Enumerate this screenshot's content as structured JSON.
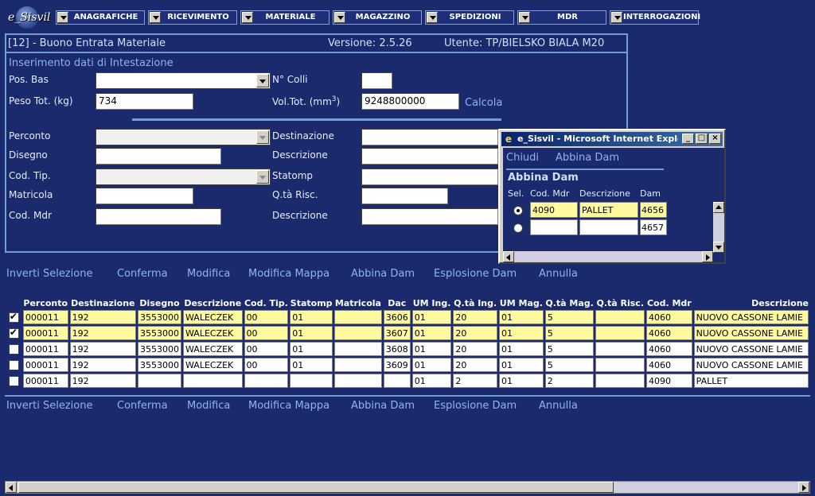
{
  "logo_text": "e_Sisvil",
  "menu": [
    {
      "label": "ANAGRAFICHE"
    },
    {
      "label": "RICEVIMENTO"
    },
    {
      "label": "MATERIALE"
    },
    {
      "label": "MAGAZZINO"
    },
    {
      "label": "SPEDIZIONI"
    },
    {
      "label": "MDR"
    },
    {
      "label": "INTERROGAZIONI"
    }
  ],
  "header": {
    "title": "[12] - Buono Entrata Materiale",
    "version": "Versione: 2.5.26",
    "user": "Utente: TP/BIELSKO BIALA M20"
  },
  "section_title": "Inserimento dati di Intestazione",
  "fields": {
    "pos_bas": {
      "label": "Pos. Bas",
      "value": ""
    },
    "n_colli": {
      "label": "N° Colli",
      "value": ""
    },
    "peso_tot": {
      "label": "Peso Tot. (kg)",
      "value": "734"
    },
    "vol_tot": {
      "label": "Vol.Tot. (mm",
      "sup": "3",
      "label_end": ")",
      "value": "9248800000"
    },
    "calcola": "Calcola",
    "perconto": {
      "label": "Perconto",
      "value": ""
    },
    "destinazione": {
      "label": "Destinazione",
      "value": ""
    },
    "disegno": {
      "label": "Disegno",
      "value": ""
    },
    "descrizione": {
      "label": "Descrizione",
      "value": ""
    },
    "cod_tip": {
      "label": "Cod. Tip.",
      "value": ""
    },
    "statomp": {
      "label": "Statomp",
      "value": ""
    },
    "matricola": {
      "label": "Matricola",
      "value": ""
    },
    "qta_risc": {
      "label": "Q.tà Risc.",
      "value": ""
    },
    "cod_mdr": {
      "label": "Cod. Mdr",
      "value": ""
    },
    "descrizione2": {
      "label": "Descrizione",
      "value": ""
    }
  },
  "actions": [
    "Inverti Selezione",
    "Conferma",
    "Modifica",
    "Modifica Mappa",
    "Abbina Dam",
    "Esplosione Dam",
    "Annulla"
  ],
  "grid": {
    "columns": [
      "Perconto",
      "Destinazione",
      "Disegno",
      "Descrizione",
      "Cod. Tip.",
      "Statomp",
      "Matricola",
      "Dac",
      "UM Ing.",
      "Q.tà Ing.",
      "UM Mag.",
      "Q.tà Mag.",
      "Q.tà Risc.",
      "Cod. Mdr",
      "Descrizione"
    ],
    "rows": [
      {
        "checked": true,
        "cells": [
          "000011",
          "192",
          "3553000",
          "WALECZEK",
          "00",
          "01",
          "",
          "3606",
          "01",
          "20",
          "01",
          "5",
          "",
          "4060",
          "NUOVO CASSONE LAMIE"
        ]
      },
      {
        "checked": true,
        "cells": [
          "000011",
          "192",
          "3553000",
          "WALECZEK",
          "00",
          "01",
          "",
          "3607",
          "01",
          "20",
          "01",
          "5",
          "",
          "4060",
          "NUOVO CASSONE LAMIE"
        ]
      },
      {
        "checked": false,
        "cells": [
          "000011",
          "192",
          "3553000",
          "WALECZEK",
          "00",
          "01",
          "",
          "3608",
          "01",
          "20",
          "01",
          "5",
          "",
          "4060",
          "NUOVO CASSONE LAMIE"
        ]
      },
      {
        "checked": false,
        "cells": [
          "000011",
          "192",
          "3553000",
          "WALECZEK",
          "00",
          "01",
          "",
          "3609",
          "01",
          "20",
          "01",
          "5",
          "",
          "4060",
          "NUOVO CASSONE LAMIE"
        ]
      },
      {
        "checked": false,
        "cells": [
          "000011",
          "192",
          "",
          "",
          "",
          "",
          "",
          "",
          "01",
          "2",
          "01",
          "2",
          "",
          "4090",
          "PALLET"
        ]
      }
    ]
  },
  "popup": {
    "title": "e_Sisvil - Microsoft Internet Explor...",
    "link_close": "Chiudi",
    "link_abbina": "Abbina Dam",
    "table_title": "Abbina Dam",
    "columns": [
      "Sel.",
      "Cod. Mdr",
      "Descrizione",
      "Dam"
    ],
    "rows": [
      {
        "selected": true,
        "cod_mdr": "4090",
        "descrizione": "PALLET",
        "dam": "4656"
      },
      {
        "selected": false,
        "cod_mdr": "",
        "descrizione": "",
        "dam": "4657"
      }
    ]
  },
  "colors": {
    "background": "#1a2a6c",
    "highlight_row": "#fffaa0",
    "accent": "#6f9ed8",
    "link": "#8fb4f0"
  }
}
